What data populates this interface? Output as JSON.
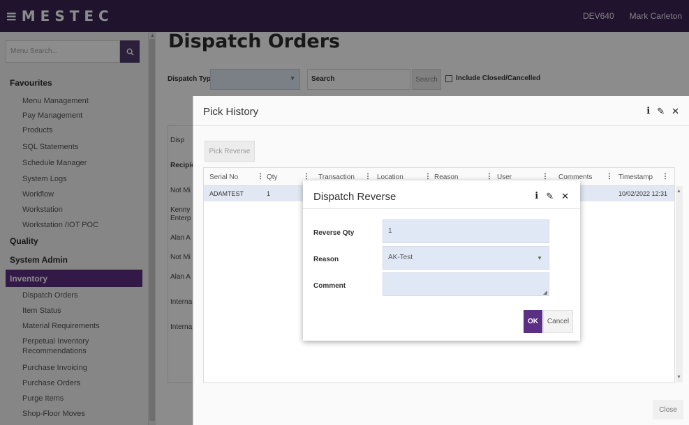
{
  "topbar": {
    "brand": "MESTEC",
    "env": "DEV640",
    "user": "Mark Carleton"
  },
  "sidebar": {
    "search_placeholder": "Menu Search...",
    "favourites": "Favourites",
    "fav_items": [
      "Menu Management",
      "Pay Management",
      "Products",
      "SQL Statements",
      "Schedule Manager",
      "System Logs",
      "Workflow",
      "Workstation",
      "Workstation /IOT POC"
    ],
    "quality": "Quality",
    "system_admin": "System Admin",
    "inventory": "Inventory",
    "inv_items": [
      "Dispatch Orders",
      "Item Status",
      "Material Requirements",
      "Perpetual Inventory",
      "Recommendations",
      "Purchase Invoicing",
      "Purchase Orders",
      "Purge Items",
      "Shop-Floor Moves"
    ]
  },
  "main": {
    "title": "Dispatch Orders",
    "dispatch_type_label": "Dispatch Type",
    "search_label": "Search",
    "search_button": "Search",
    "include_closed_label": "Include Closed/Cancelled",
    "behind_cells": [
      "Disp",
      "Recipie",
      "Not Mi",
      "Kenny",
      "Enterp",
      "Alan A",
      "Not Mi",
      "Alan A",
      "Interna",
      "Interna"
    ]
  },
  "pick_history": {
    "title": "Pick History",
    "pick_reverse": "Pick Reverse",
    "columns": [
      "Serial No",
      "Qty",
      "Transaction",
      "Location",
      "Reason",
      "User",
      "Comments",
      "Timestamp"
    ],
    "row": {
      "serial": "ADAMTEST",
      "qty": "1",
      "timestamp": "10/02/2022 12:31"
    },
    "close": "Close"
  },
  "dispatch_reverse": {
    "title": "Dispatch Reverse",
    "reverse_qty_label": "Reverse Qty",
    "reverse_qty_value": "1",
    "reason_label": "Reason",
    "reason_value": "AK-Test",
    "comment_label": "Comment",
    "comment_value": "",
    "ok": "OK",
    "cancel": "Cancel"
  }
}
